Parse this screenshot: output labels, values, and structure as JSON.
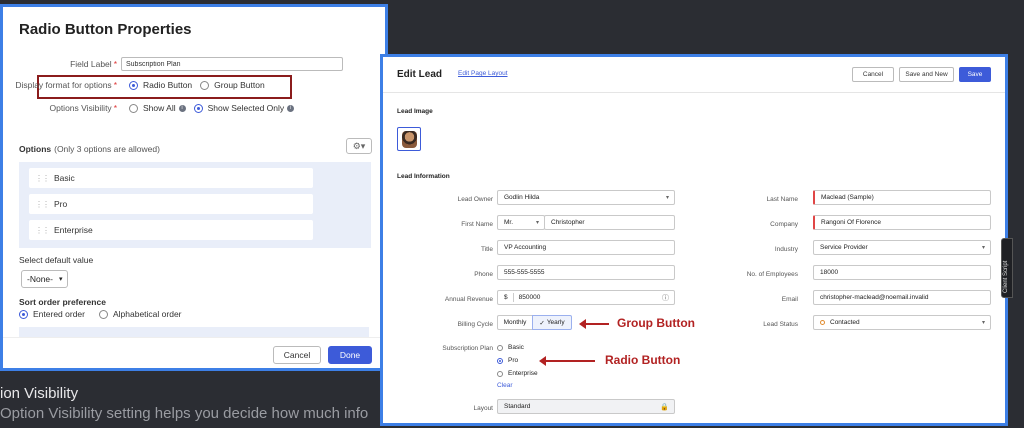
{
  "background": {
    "heading": "ion Visibility",
    "line": "Option Visibility setting helps you decide how much info"
  },
  "radio_props": {
    "title": "Radio Button Properties",
    "field_label_label": "Field Label",
    "field_label_value": "Subscription Plan",
    "display_format_label": "Display format for options",
    "opt_radio": "Radio Button",
    "opt_group": "Group Button",
    "visibility_label": "Options Visibility",
    "show_all": "Show All",
    "show_selected": "Show Selected Only",
    "options_title": "Options",
    "options_sub": "(Only 3 options are allowed)",
    "options": [
      "Basic",
      "Pro",
      "Enterprise"
    ],
    "default_label": "Select default value",
    "default_value": "-None-",
    "sort_label": "Sort order preference",
    "sort_entered": "Entered order",
    "sort_alpha": "Alphabetical order",
    "cancel": "Cancel",
    "done": "Done"
  },
  "edit_lead": {
    "title": "Edit Lead",
    "edit_layout": "Edit Page Layout",
    "cancel": "Cancel",
    "save_new": "Save and New",
    "save": "Save",
    "lead_image": "Lead Image",
    "lead_info": "Lead Information",
    "left_fields": {
      "owner_label": "Lead Owner",
      "owner": "Godlin Hilda",
      "first_label": "First Name",
      "salutation": "Mr.",
      "first": "Christopher",
      "title_label": "Title",
      "title": "VP Accounting",
      "phone_label": "Phone",
      "phone": "555-555-5555",
      "revenue_label": "Annual Revenue",
      "currency": "$",
      "revenue": "850000",
      "billing_label": "Billing Cycle",
      "monthly": "Monthly",
      "yearly": "Yearly",
      "plan_label": "Subscription Plan",
      "plan_basic": "Basic",
      "plan_pro": "Pro",
      "plan_enterprise": "Enterprise",
      "clear": "Clear",
      "layout_label": "Layout",
      "layout": "Standard"
    },
    "right_fields": {
      "last_label": "Last Name",
      "last": "Maclead (Sample)",
      "company_label": "Company",
      "company": "Rangoni Of Florence",
      "industry_label": "Industry",
      "industry": "Service Provider",
      "employees_label": "No. of Employees",
      "employees": "18000",
      "email_label": "Email",
      "email": "christopher-maclead@noemail.invalid",
      "status_label": "Lead Status",
      "status": "Contacted"
    },
    "annotation_group": "Group Button",
    "annotation_radio": "Radio Button"
  },
  "client_script": "Client Script"
}
